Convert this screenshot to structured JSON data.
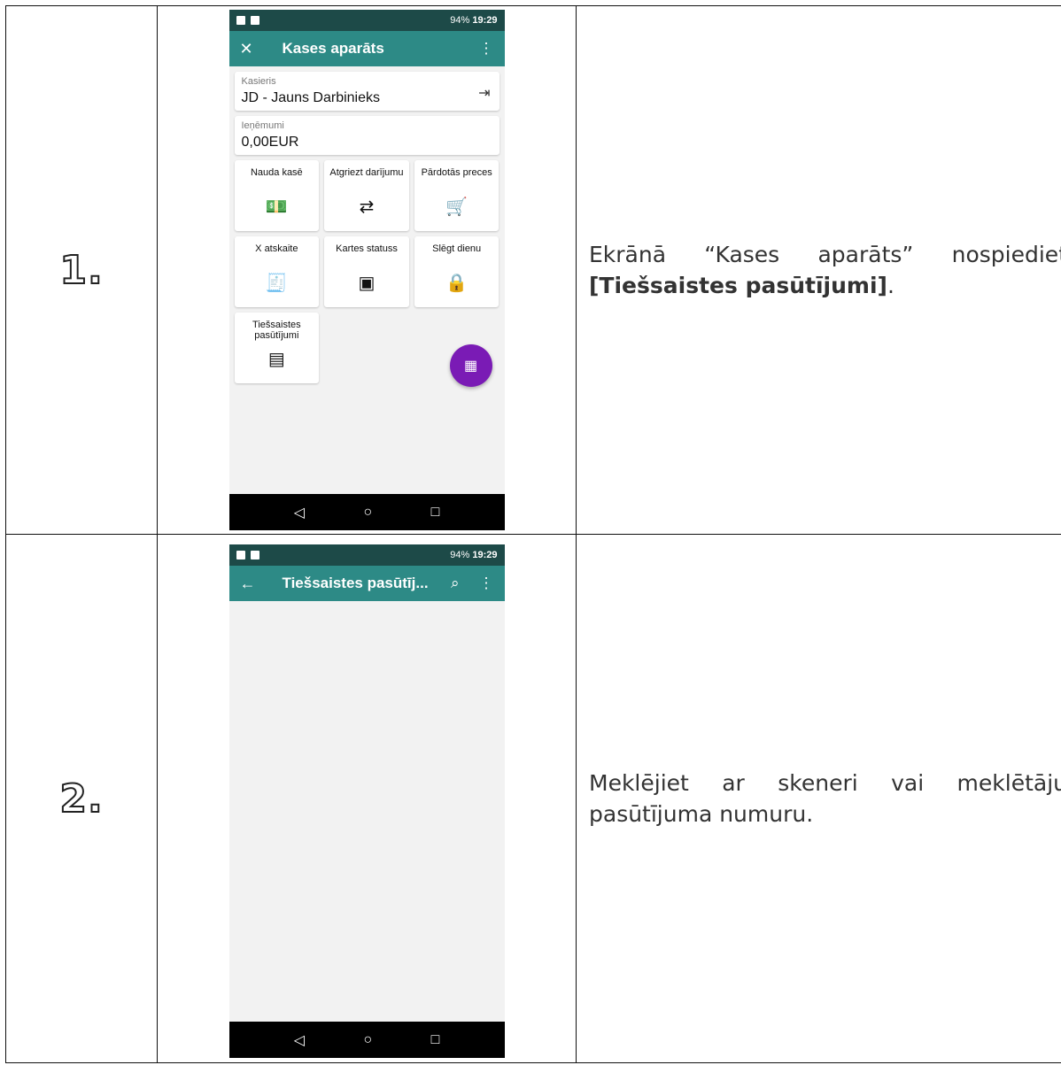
{
  "steps": [
    {
      "number": "1.",
      "phone": {
        "status_time": "19:29",
        "status_battery": "94%",
        "appbar_title": "Kases aparāts",
        "close_glyph": "✕",
        "menu_glyph": "⋮",
        "cashier_label": "Kasieris",
        "cashier_value": "JD - Jauns Darbinieks",
        "revenue_label": "Ieņēmumi",
        "revenue_value": "0,00EUR",
        "tiles": [
          {
            "label": "Nauda kasē",
            "icon": "cash-icon"
          },
          {
            "label": "Atgriezt darījumu",
            "icon": "return-icon"
          },
          {
            "label": "Pārdotās preces",
            "icon": "cart-icon"
          },
          {
            "label": "X atskaite",
            "icon": "report-icon"
          },
          {
            "label": "Kartes statuss",
            "icon": "wallet-icon"
          },
          {
            "label": "Slēgt dienu",
            "icon": "close-sign-icon"
          },
          {
            "label": "Tiešsaistes pasūtījumi",
            "icon": "archive-icon"
          }
        ]
      },
      "text_before": "Ekrānā “Kases aparāts” nospiediet ",
      "text_bold": "[Tiešsaistes pasūtījumi]",
      "text_after": "."
    },
    {
      "number": "2.",
      "phone": {
        "status_time": "19:29",
        "status_battery": "94%",
        "appbar_title": "Tiešsaistes pasūtīj...",
        "back_glyph": "←",
        "search_glyph": "🔍",
        "menu_glyph": "⋮"
      },
      "text": "Meklējiet ar skeneri vai meklētāju pasūtījuma numuru."
    }
  ],
  "nav": {
    "back": "◁",
    "home": "○",
    "recent": "□"
  }
}
